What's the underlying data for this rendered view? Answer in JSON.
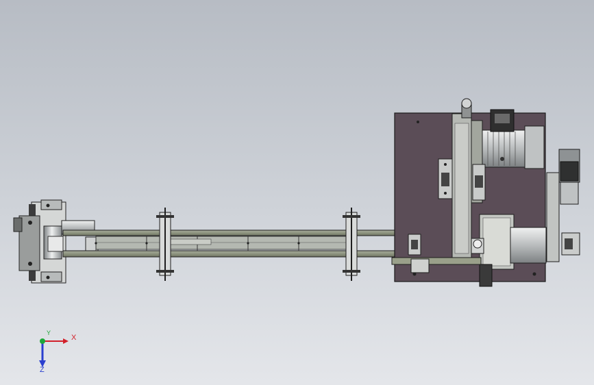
{
  "viewport": {
    "background_top": "#b7bcc4",
    "background_bottom": "#e4e6ea"
  },
  "model": {
    "plate_color": "#5b4d57",
    "frame_color": "#8c9184",
    "steel_color": "#c8cbcc",
    "dark_color": "#2a2a2a",
    "motor_color": "#9ea3a6"
  },
  "triad": {
    "x_label": "X",
    "y_label": "Y",
    "z_label": "Z",
    "x_color": "#d2202a",
    "y_color": "#1fa83a",
    "z_color": "#2a3fcf"
  }
}
